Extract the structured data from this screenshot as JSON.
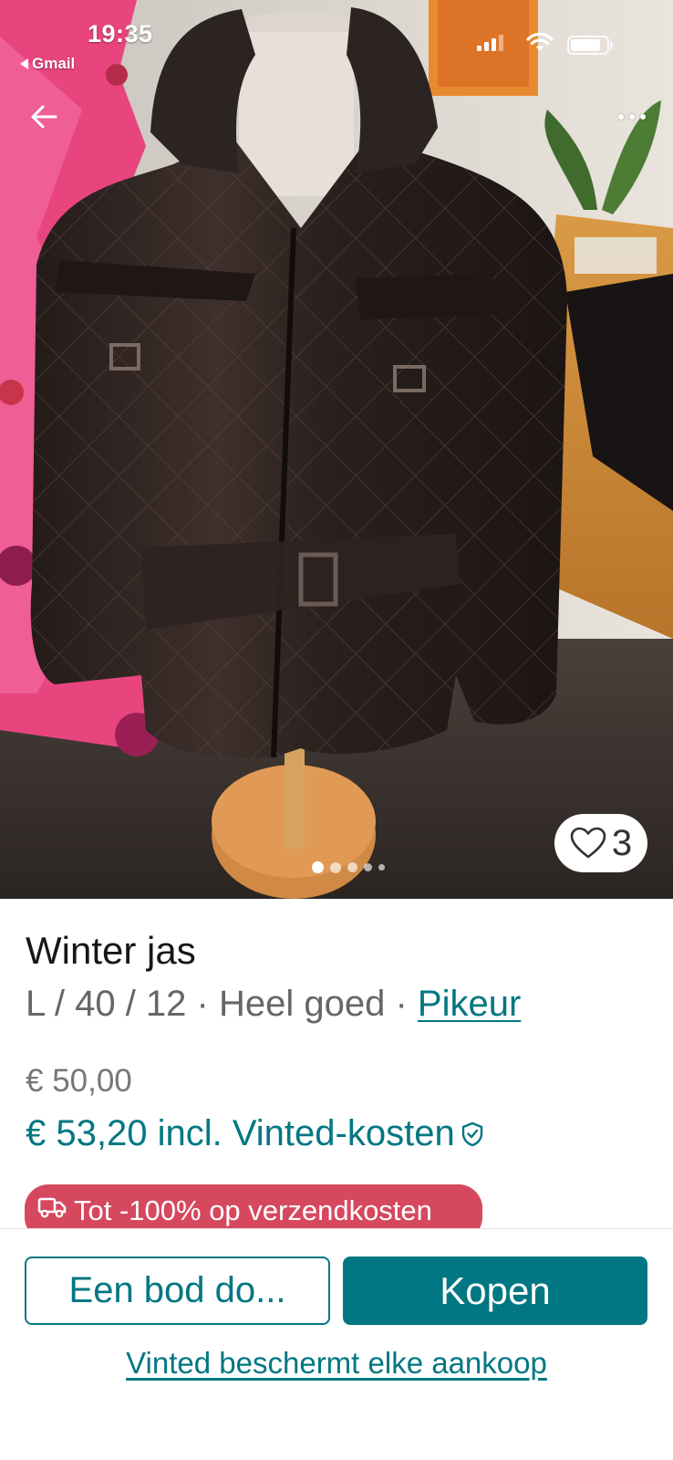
{
  "status_bar": {
    "time": "19:35",
    "back_app": "Gmail"
  },
  "photo": {
    "favorite_count": "3",
    "pager_total": 5,
    "pager_active": 1
  },
  "item": {
    "title": "Winter jas",
    "details": "L / 40 / 12 · Heel goed · ",
    "brand": "Pikeur",
    "price": "€ 50,00",
    "price_total": "€ 53,20 incl. Vinted-kosten"
  },
  "promo": {
    "label": "Tot -100% op verzendkosten"
  },
  "actions": {
    "offer_label": "Een bod do...",
    "buy_label": "Kopen",
    "protection_link": "Vinted beschermt elke aankoop"
  },
  "colors": {
    "accent": "#007782",
    "promo": "#d6485e"
  },
  "icons": [
    "back-arrow-icon",
    "more-icon",
    "heart-icon",
    "shield-check-icon",
    "truck-icon",
    "wifi-icon",
    "signal-icon",
    "battery-icon"
  ]
}
